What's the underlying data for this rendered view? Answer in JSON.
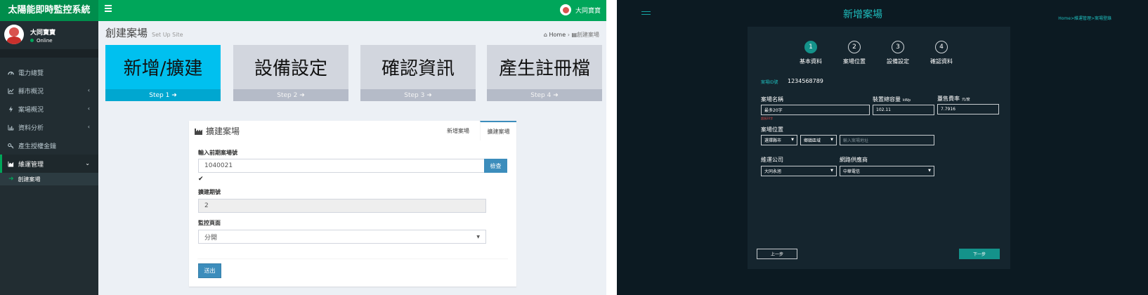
{
  "left": {
    "brand": "太陽能即時監控系統",
    "user_name": "大同寶寶",
    "user_status": "Online",
    "menu": [
      {
        "label": "電力總覽",
        "chevron": false
      },
      {
        "label": "縣市概況",
        "chevron": true
      },
      {
        "label": "案場概況",
        "chevron": true
      },
      {
        "label": "資料分析",
        "chevron": true
      },
      {
        "label": "產生授權金鑰",
        "chevron": false
      },
      {
        "label": "維運管理",
        "chevron": true,
        "active": true
      }
    ],
    "submenu_item": "創建案場",
    "page_title": "創建案場",
    "page_subtitle": "Set Up Site",
    "breadcrumb": {
      "home": "Home",
      "current": "創建案場"
    },
    "steps": [
      {
        "title": "新增/擴建",
        "footer": "Step 1 ➜"
      },
      {
        "title": "設備設定",
        "footer": "Step 2 ➜"
      },
      {
        "title": "確認資訊",
        "footer": "Step 3 ➜"
      },
      {
        "title": "產生註冊檔",
        "footer": "Step 4 ➜"
      }
    ],
    "box": {
      "title": "擴建案場",
      "tab_new": "新增案場",
      "tab_expand": "擴建案場",
      "prev_site_label": "輸入前期案場號",
      "prev_site_value": "1040021",
      "check_button": "檢查",
      "check_mark": "✔",
      "phase_label": "擴建期號",
      "phase_value": "2",
      "monitor_label": "監控頁面",
      "monitor_value": "分開",
      "submit": "送出"
    }
  },
  "right": {
    "title": "新增案場",
    "breadcrumb": "Home>維運管理>案場登錄",
    "steps": [
      {
        "num": "1",
        "label": "基本資料",
        "active": true
      },
      {
        "num": "2",
        "label": "案場位置",
        "active": false
      },
      {
        "num": "3",
        "label": "設備設定",
        "active": false
      },
      {
        "num": "4",
        "label": "確認資料",
        "active": false
      }
    ],
    "site_id_label": "案場ID號",
    "site_id_value": "1234568789",
    "site_name_label": "案場名稱",
    "site_name_value": "最多20字",
    "site_name_error": "超過20字",
    "capacity_label": "裝置總容量",
    "capacity_unit": "kWp",
    "capacity_value": "102.11",
    "rate_label": "躉售費率",
    "rate_unit": "元/度",
    "rate_value": "7.7916",
    "location_label": "案場位置",
    "county_select": "選擇縣市",
    "district_select": "鄉鎮區域",
    "address_placeholder": "輸入案場地址",
    "maint_label": "維運公司",
    "maint_value": "大同永旭",
    "isp_label": "網路供應商",
    "isp_value": "中華電信",
    "prev_button": "上一步",
    "next_button": "下一步"
  },
  "colors": {
    "green": "#00a65a",
    "sidebar": "#222d32",
    "teal": "#1fbfbf",
    "dark_bg": "#0c1a22",
    "blue": "#3c8dbc"
  }
}
